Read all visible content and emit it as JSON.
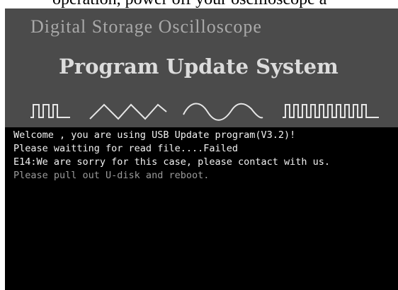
{
  "cropped_text": "operation, power off your oscilloscope a",
  "header": {
    "subtitle": "Digital Storage Oscilloscope",
    "title": "Program Update System",
    "waveforms": [
      "square-pulse-icon",
      "triangle-wave-icon",
      "sine-wave-icon",
      "square-wave-icon"
    ]
  },
  "console": {
    "lines": [
      "Welcome , you are using USB Update program(V3.2)!",
      "Please waitting for read file....Failed",
      "E14:We are sorry for this case, please contact with us.",
      "Please pull out U-disk and reboot."
    ]
  },
  "colors": {
    "header_bg": "#4b4b4b",
    "screen_bg": "#000000",
    "title": "#dcdcdc",
    "subtitle": "#a9a9a9",
    "text": "#f2f2f2",
    "text_dim": "#9a9a9a"
  }
}
